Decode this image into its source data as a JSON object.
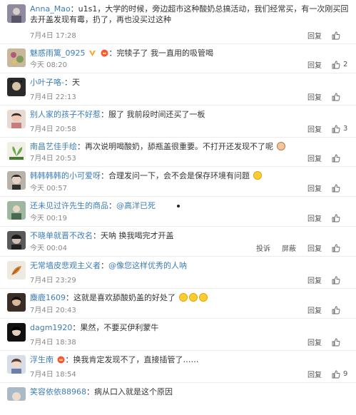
{
  "labels": {
    "reply": "回复",
    "report": "投诉",
    "block": "屏蔽"
  },
  "comments": [
    {
      "user": "Anna_Mao",
      "text": "u1s1，大学的时候，旁边超市这种酸奶总搞活动，我们经常买，有一次刚买回去开盖发现有霉，扔了，再也没买过这种",
      "date": "7月4日 17:28",
      "likes": ""
    },
    {
      "user": "魅惑雨篱_0925",
      "text": "完犊子了 我一直用的吸管喝",
      "date": "今天 08:20",
      "likes": "2"
    },
    {
      "user": "小叶子咯-",
      "text": "天",
      "date": "7月4日 22:13",
      "likes": ""
    },
    {
      "user": "别人家的孩子不好惹",
      "text": "服了 我前段时间还买了一板",
      "date": "7月4日 20:58",
      "likes": "3"
    },
    {
      "user": "南昌艺佳手绘",
      "text": "再次说明喝酸奶，舔瓶盖很重要。不打开还发现不了呢",
      "date": "7月4日 20:53",
      "likes": ""
    },
    {
      "user": "韩韩韩韩的小可爱呀",
      "text": "合理发问一下，会不会是保存环境有问题",
      "date": "今天 00:57",
      "likes": ""
    },
    {
      "user": "还未见过许先生的商品",
      "mention": "@高洋已死",
      "date": "今天 00:19",
      "likes": ""
    },
    {
      "user": "不晓单就晋不改名",
      "text": "天呐 换我喝完才开盖",
      "date": "今天 00:04",
      "likes": ""
    },
    {
      "user": "无常墙皮悲观主义者",
      "mention": "@像您这样优秀的人呐",
      "date": "7月4日 23:29",
      "likes": ""
    },
    {
      "user": "麋鹿1609",
      "text": "这就是喜欢舔酸奶盖的好处了",
      "date": "7月4日 20:43",
      "likes": ""
    },
    {
      "user": "dagm1920",
      "text": "果然，不要买伊利蒙牛",
      "date": "7月4日 18:38",
      "likes": ""
    },
    {
      "user": "浮生南",
      "text": "换我肯定发现不了，直接插管了……",
      "date": "7月4日 18:54",
      "likes": "9"
    },
    {
      "user": "笑容依依88968",
      "text": "病从口入就是这个原因",
      "date": "",
      "likes": ""
    }
  ]
}
